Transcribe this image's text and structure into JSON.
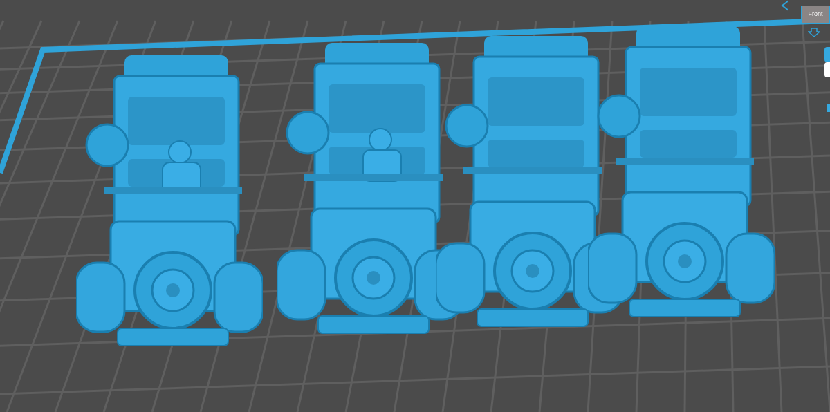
{
  "view_cube": {
    "face_label": "Front"
  },
  "side_tabs": [
    {
      "selected": true
    },
    {
      "selected": false
    }
  ],
  "models": [
    {
      "driver": true
    },
    {
      "driver": true
    },
    {
      "driver": false
    },
    {
      "driver": false
    }
  ]
}
